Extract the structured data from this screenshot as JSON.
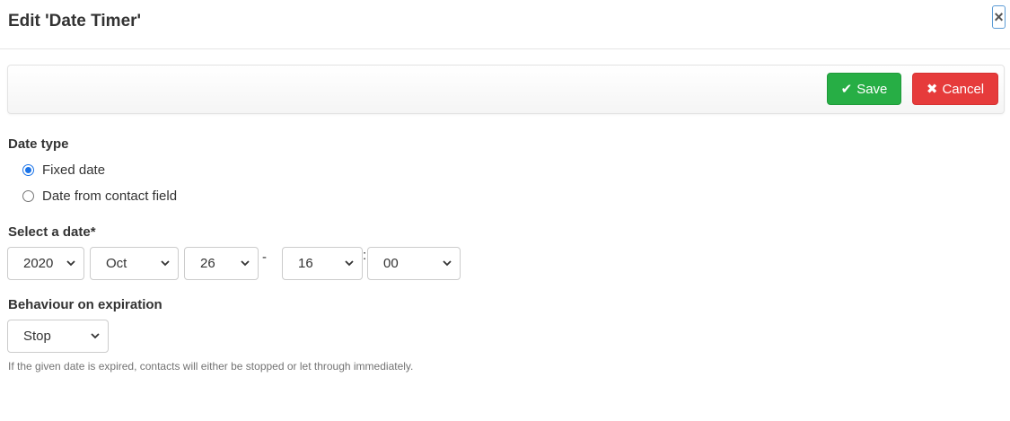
{
  "modal": {
    "title": "Edit 'Date Timer'",
    "close_label": "×"
  },
  "toolbar": {
    "save_label": "Save",
    "cancel_label": "Cancel",
    "save_icon": "check-icon",
    "cancel_icon": "times-icon"
  },
  "date_type": {
    "label": "Date type",
    "options": [
      {
        "label": "Fixed date",
        "selected": true
      },
      {
        "label": "Date from contact field",
        "selected": false
      }
    ]
  },
  "select_date": {
    "label": "Select a date*",
    "year": "2020",
    "month": "Oct",
    "day": "26",
    "hour": "16",
    "minute": "00",
    "date_time_separator": "-",
    "time_separator": ":"
  },
  "expiration": {
    "label": "Behaviour on expiration",
    "value": "Stop",
    "help_text": "If the given date is expired, contacts will either be stopped or let through immediately."
  },
  "colors": {
    "save": "#27ae45",
    "cancel": "#e63b3b",
    "radio_checked": "#1a73e8"
  }
}
